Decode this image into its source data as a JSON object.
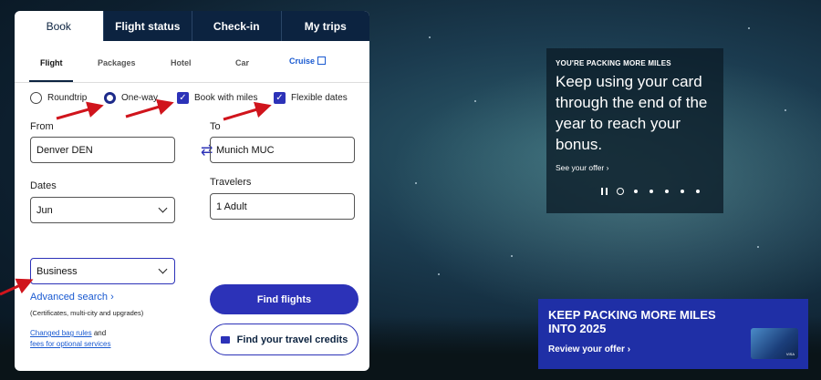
{
  "top_tabs": [
    "Book",
    "Flight status",
    "Check-in",
    "My trips"
  ],
  "sub_tabs": [
    "Flight",
    "Packages",
    "Hotel",
    "Car",
    "Cruise"
  ],
  "trip_options": {
    "roundtrip": "Roundtrip",
    "oneway": "One-way",
    "book_with_miles": "Book with miles",
    "flexible_dates": "Flexible dates"
  },
  "form": {
    "from_label": "From",
    "from_value": "Denver DEN",
    "to_label": "To",
    "to_value": "Munich MUC",
    "dates_label": "Dates",
    "dates_value": "Jun",
    "travelers_label": "Travelers",
    "travelers_value": "1 Adult",
    "cabin_value": "Business"
  },
  "advanced": {
    "link": "Advanced search",
    "note": "(Certificates, multi-city and upgrades)"
  },
  "links": {
    "bag_rules": "Changed bag rules",
    "and": "and",
    "fees": "fees for optional services"
  },
  "buttons": {
    "find_flights": "Find flights",
    "find_credits": "Find your travel credits"
  },
  "promo": {
    "kicker": "YOU'RE PACKING MORE MILES",
    "headline": "Keep using your card through the end of the year to reach your bonus.",
    "link": "See your offer"
  },
  "banner": {
    "headline_1": "KEEP PACKING MORE MILES",
    "headline_2": "INTO 2025",
    "link": "Review your offer"
  },
  "colors": {
    "navy": "#0c2340",
    "brand_blue": "#2c32b8",
    "annotation_red": "#d0141c"
  }
}
